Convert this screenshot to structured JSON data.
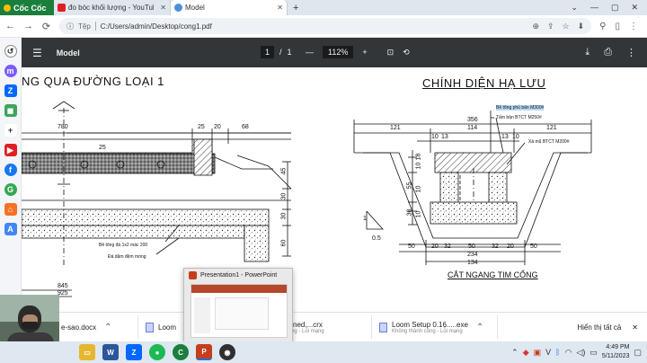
{
  "browser": {
    "logo_label": "Cốc Cốc",
    "tabs": [
      {
        "label": "đo bóc khối lượng - YouTube",
        "color": "#e02020",
        "active": false
      },
      {
        "label": "Model",
        "color": "#4a90d9",
        "active": true
      }
    ],
    "new_tab": "+",
    "window_controls": [
      "⌄",
      "—",
      "▢",
      "✕"
    ]
  },
  "addressbar": {
    "back": "←",
    "forward": "→",
    "reload": "⟳",
    "prefix": "Tệp",
    "url": "C:/Users/admin/Desktop/cong1.pdf"
  },
  "pdf": {
    "document_name": "Model",
    "current_page": "1",
    "page_separator": "/",
    "total_pages": "1",
    "zoom_minus": "—",
    "zoom_value": "112%",
    "zoom_plus": "+"
  },
  "drawing": {
    "left_title": "NG QUA ĐƯỜNG LOẠI 1",
    "right_title": "CHÍNH DIỆN HẠ LƯU",
    "section_title": "CẮT NGANG TIM CỐNG",
    "left_dims": [
      "780",
      "25",
      "20",
      "68",
      "25",
      "45",
      "30",
      "30",
      "60",
      "845",
      "925"
    ],
    "left_notes": [
      "Bê tông đá 1x2 mác 200",
      "Đá dăm đệm móng"
    ],
    "right_dims_top": [
      "356",
      "121",
      "114",
      "121",
      "10",
      "13",
      "13",
      "10"
    ],
    "right_dims_side": [
      "18",
      "10",
      "55",
      "10",
      "30",
      "10"
    ],
    "right_dims_bottom": [
      "50",
      "20",
      "32",
      "50",
      "32",
      "20",
      "50",
      "234",
      "134"
    ],
    "right_notes": [
      "Bê tông phủ bản M300#",
      "Tấm bản BTCT M250#",
      "Xà mũ BTCT M200#"
    ],
    "slope_labels": [
      "1",
      "0.5"
    ]
  },
  "downloads": {
    "items": [
      {
        "name": "e-sao.docx",
        "sub": ""
      },
      {
        "name": "Loom",
        "sub": ""
      },
      {
        "name": "iecbddmkiiihned....crx",
        "sub": "Không thành công - Lỗi mạng"
      },
      {
        "name": "Loom Setup 0.16.....exe",
        "sub": "Không thành công - Lỗi mạng"
      }
    ],
    "show_all": "Hiển thị tất cả",
    "close": "✕"
  },
  "preview": {
    "title": "Presentation1 - PowerPoint"
  },
  "taskbar": {
    "apps": [
      {
        "name": "file-explorer-icon",
        "glyph": "▭",
        "color": "#e7b62f"
      },
      {
        "name": "word-icon",
        "glyph": "W",
        "color": "#2b579a"
      },
      {
        "name": "zalo-icon",
        "glyph": "Z",
        "color": "#0068ff"
      },
      {
        "name": "spotify-icon",
        "glyph": "●",
        "color": "#1db954"
      },
      {
        "name": "coccoc-icon",
        "glyph": "C",
        "color": "#1a7f3c"
      },
      {
        "name": "powerpoint-icon",
        "glyph": "P",
        "color": "#c43e1c"
      },
      {
        "name": "obs-icon",
        "glyph": "◉",
        "color": "#302e31"
      }
    ],
    "time": "4:49 PM",
    "date": "5/11/2023"
  }
}
